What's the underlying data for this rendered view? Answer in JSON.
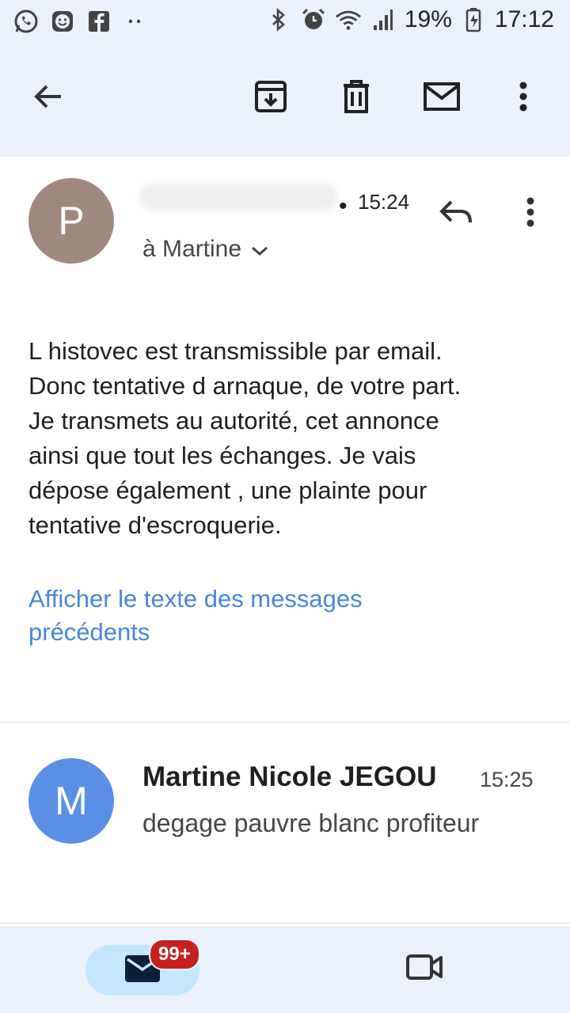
{
  "status_bar": {
    "battery": "19%",
    "time": "17:12",
    "left_icons": [
      "whatsapp-icon",
      "smiley-app-icon",
      "facebook-icon",
      "more-notifications-icon"
    ],
    "right_icons": [
      "bluetooth-icon",
      "alarm-icon",
      "wifi-icon",
      "signal-icon",
      "battery-icon"
    ]
  },
  "toolbar": {
    "icons": [
      "back-arrow-icon",
      "archive-icon",
      "delete-icon",
      "mark-unread-icon",
      "more-vert-icon"
    ]
  },
  "message1": {
    "avatar_letter": "P",
    "avatar_color": "#a1887f",
    "time": "15:24",
    "to_label": "à Martine",
    "body_lines": [
      "L histovec est transmissible par email.",
      "Donc tentative d arnaque, de votre part.",
      "Je transmets au autorité, cet annonce",
      "ainsi que tout les échanges.  Je vais",
      "dépose également  , une plainte pour",
      "tentative d'escroquerie."
    ],
    "show_previous": "Afficher le texte des messages précédents"
  },
  "message2": {
    "avatar_letter": "M",
    "avatar_color": "#5a8fe6",
    "sender": "Martine Nicole JEGOU",
    "time": "15:25",
    "snippet": "degage pauvre blanc profiteur"
  },
  "bottom_nav": {
    "mail_badge": "99+",
    "accent": "#c2e7ff",
    "badge_color": "#c5221f"
  }
}
